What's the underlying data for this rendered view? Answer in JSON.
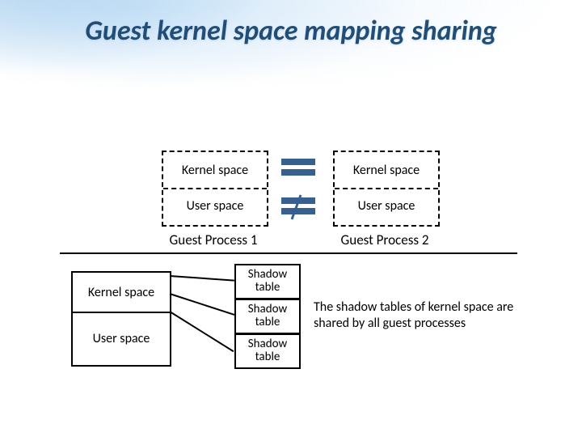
{
  "title": "Guest kernel space mapping sharing",
  "upper": {
    "left": {
      "kernel": "Kernel space",
      "user": "User space",
      "label": "Guest Process 1"
    },
    "right": {
      "kernel": "Kernel space",
      "user": "User space",
      "label": "Guest Process 2"
    },
    "equal_relation": "kernel",
    "not_equal_relation": "user"
  },
  "lower": {
    "guest": {
      "kernel": "Kernel space",
      "user": "User space"
    },
    "shadow_tables": [
      "Shadow table",
      "Shadow table",
      "Shadow table"
    ],
    "caption": "The shadow tables of kernel space are shared by all guest processes"
  }
}
